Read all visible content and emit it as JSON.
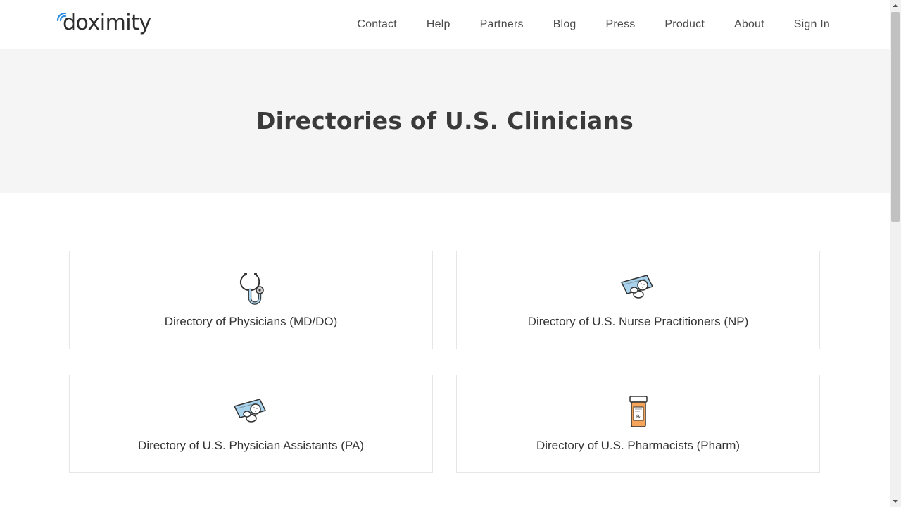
{
  "header": {
    "logo_text": "doximity",
    "nav": [
      {
        "label": "Contact"
      },
      {
        "label": "Help"
      },
      {
        "label": "Partners"
      },
      {
        "label": "Blog"
      },
      {
        "label": "Press"
      },
      {
        "label": "Product"
      },
      {
        "label": "About"
      },
      {
        "label": "Sign In"
      }
    ]
  },
  "hero": {
    "title": "Directories of U.S. Clinicians"
  },
  "cards": [
    {
      "label": "Directory of Physicians (MD/DO)",
      "icon": "stethoscope-icon"
    },
    {
      "label": "Directory of U.S. Nurse Practitioners (NP)",
      "icon": "pills-icon"
    },
    {
      "label": "Directory of U.S. Physician Assistants (PA)",
      "icon": "pills-icon"
    },
    {
      "label": "Directory of U.S. Pharmacists (Pharm)",
      "icon": "pill-bottle-icon"
    }
  ],
  "colors": {
    "brand_blue": "#2f8ee0",
    "hero_bg": "#f5f5f5",
    "text": "#333333"
  }
}
